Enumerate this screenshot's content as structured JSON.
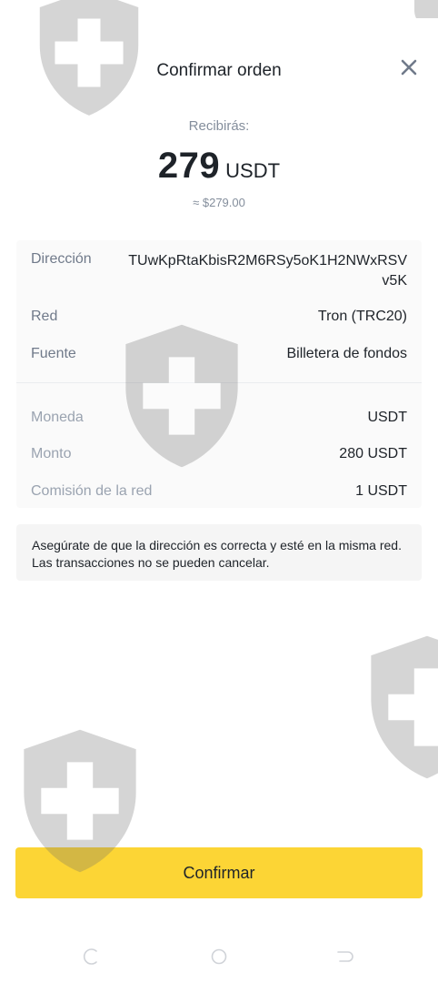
{
  "dialog": {
    "title": "Confirmar orden",
    "close_icon": "close-icon"
  },
  "summary": {
    "receive_label": "Recibirás:",
    "amount": "279",
    "currency": "USDT",
    "approx_value": "≈ $279.00"
  },
  "details": {
    "address": {
      "label": "Dirección",
      "value": "TUwKpRtaKbisR2M6RSy5oK1H2NWxRSVv5K"
    },
    "network": {
      "label": "Red",
      "value": "Tron (TRC20)"
    },
    "source": {
      "label": "Fuente",
      "value": "Billetera de fondos"
    },
    "coin": {
      "label": "Moneda",
      "value": "USDT"
    },
    "amount": {
      "label": "Monto",
      "value": "280 USDT"
    },
    "fee": {
      "label": "Comisión de la red",
      "value": "1 USDT"
    }
  },
  "notice": {
    "text": "Asegúrate de que la dirección es correcta y esté en la misma red. Las transacciones no se pueden cancelar."
  },
  "actions": {
    "confirm_label": "Confirmar"
  },
  "colors": {
    "accent": "#fcd535",
    "text_primary": "#1e2329",
    "text_secondary": "#848e9c"
  },
  "system_nav": {
    "icons": [
      "recents-icon",
      "home-icon",
      "back-icon"
    ]
  }
}
